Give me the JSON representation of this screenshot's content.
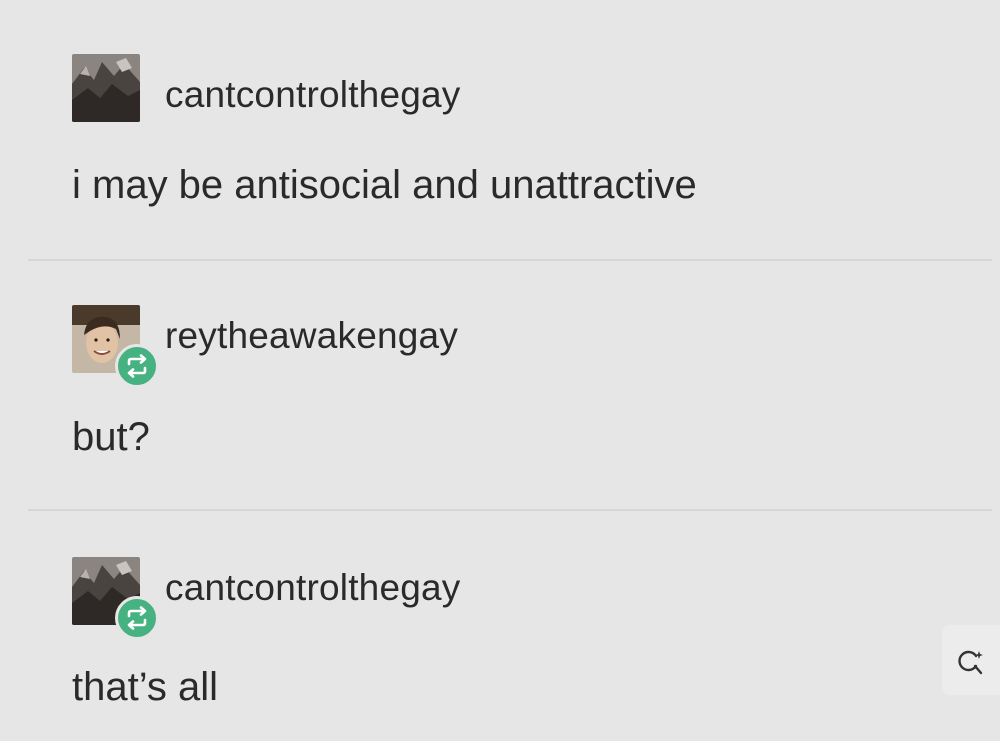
{
  "posts": [
    {
      "username": "cantcontrolthegay",
      "text": "i may be antisocial and unattractive",
      "avatar_icon": "avatar-rocky-landscape",
      "reblog": false
    },
    {
      "username": "reytheawakengay",
      "text": "but?",
      "avatar_icon": "avatar-smiling-person",
      "reblog": true
    },
    {
      "username": "cantcontrolthegay",
      "text": "that’s all",
      "avatar_icon": "avatar-rocky-landscape",
      "reblog": true
    }
  ],
  "reblog_icon": "reblog-icon",
  "reblog_color": "#46b281",
  "background_color": "#e6e6e6",
  "floating_action_icon": "search-sparkle-icon"
}
